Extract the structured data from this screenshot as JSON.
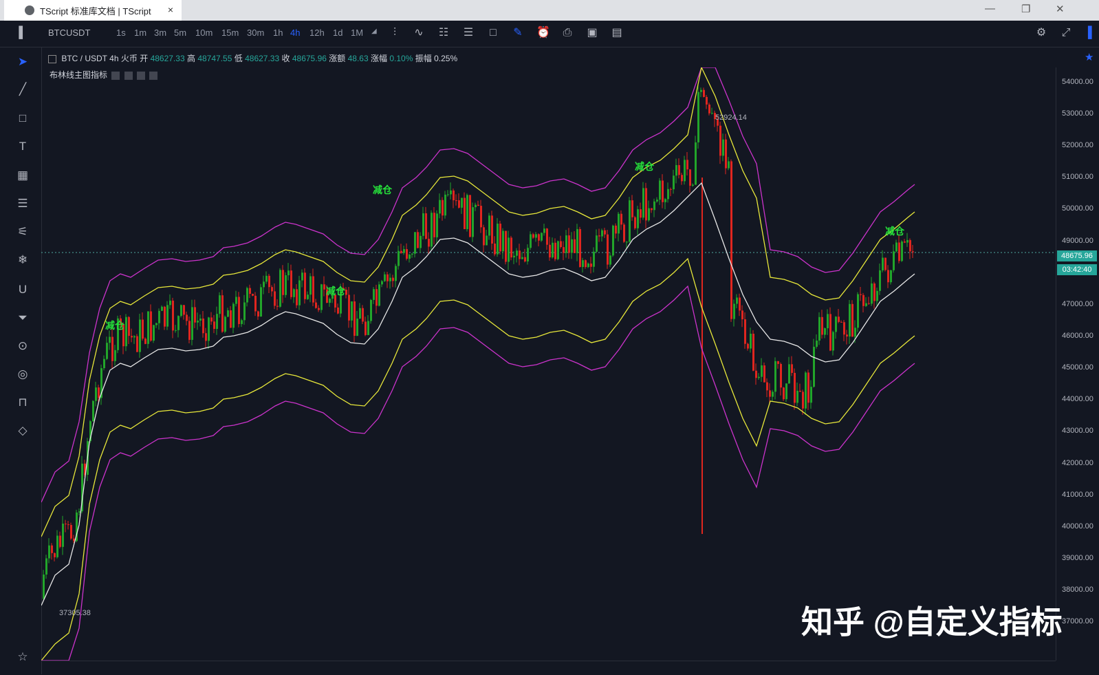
{
  "browser": {
    "tab_title": "TScript 标准库文档 | TScript",
    "tab_close": "×",
    "win_min": "—",
    "win_max": "❐",
    "win_close": "✕"
  },
  "toolbar": {
    "symbol": "BTCUSDT",
    "timeframes": [
      "1s",
      "1m",
      "3m",
      "5m",
      "10m",
      "15m",
      "30m",
      "1h",
      "4h",
      "12h",
      "1d",
      "1M"
    ],
    "active_timeframe": "4h"
  },
  "legend": {
    "pair": "BTC / USDT",
    "interval": "4h",
    "exchange": "火币",
    "open_label": "开",
    "open": "48627.33",
    "high_label": "高",
    "high": "48747.55",
    "low_label": "低",
    "low": "48627.33",
    "close_label": "收",
    "close": "48675.96",
    "change_label": "涨额",
    "change": "48.63",
    "change_pct_label": "涨幅",
    "change_pct": "0.10%",
    "amp_label": "振幅",
    "amp": "0.25%"
  },
  "indicator": {
    "name": "布林线主图指标"
  },
  "price_axis": {
    "labels": [
      "54000.00",
      "53000.00",
      "52000.00",
      "51000.00",
      "50000.00",
      "49000.00",
      "48000.00",
      "47000.00",
      "46000.00",
      "45000.00",
      "44000.00",
      "43000.00",
      "42000.00",
      "41000.00",
      "40000.00",
      "39000.00",
      "38000.00",
      "37000.00"
    ],
    "current_price": "48675.96",
    "countdown": "03:42:40"
  },
  "annotations": {
    "reduce": "减仓",
    "high_mark": "52924.14",
    "low_mark": "37305.38"
  },
  "watermark": "知乎 @自定义指标",
  "colors": {
    "background": "#131722",
    "up": "#22a52a",
    "down": "#e0261f",
    "upper_band": "#cc33cc",
    "mid_band": "#e8e8e8",
    "inner_band": "#e8e83a",
    "accent": "#2962ff",
    "price_tag": "#26a69a"
  }
}
